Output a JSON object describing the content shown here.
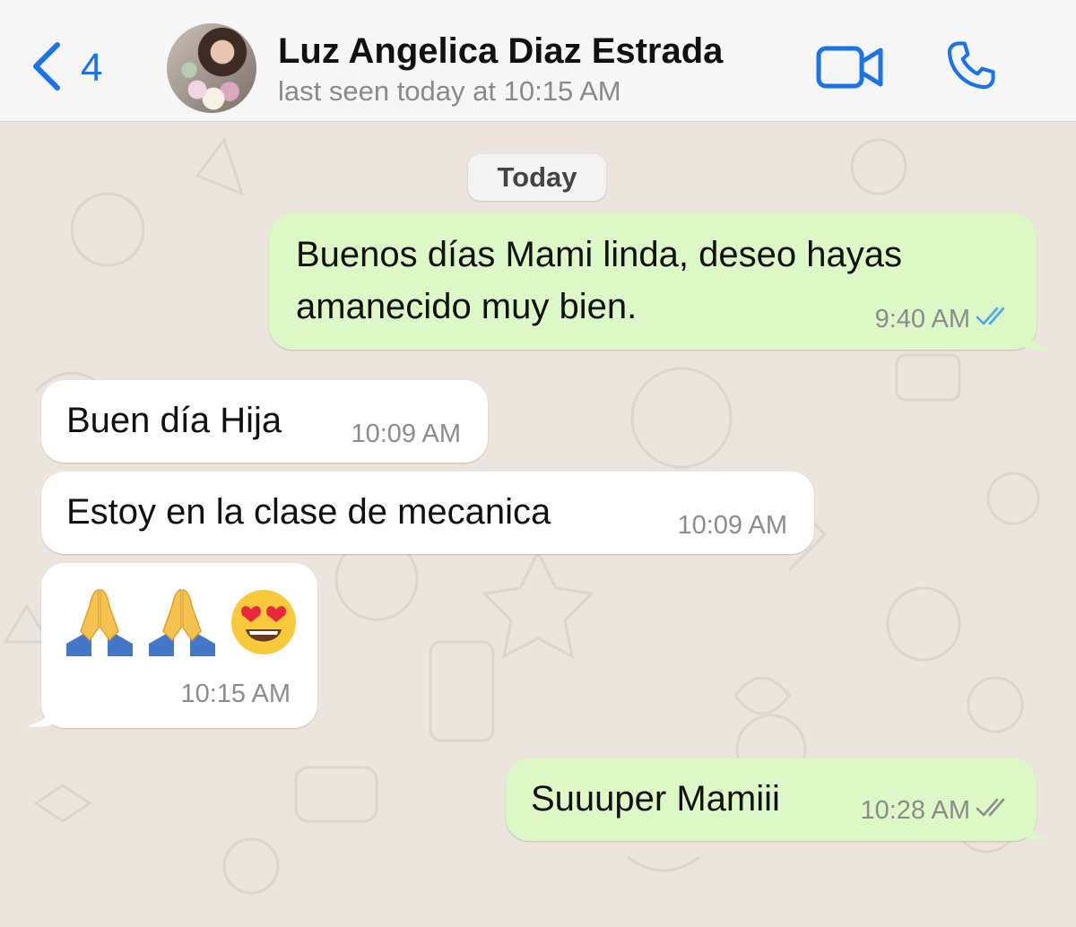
{
  "header": {
    "back_count": "4",
    "contact_name": "Luz Angelica Diaz Estrada",
    "last_seen": "last seen today at 10:15 AM"
  },
  "chat": {
    "date_label": "Today",
    "messages": [
      {
        "direction": "outgoing",
        "lines": [
          "Buenos días Mami linda, deseo hayas",
          "amanecido muy bien."
        ],
        "time": "9:40 AM",
        "status": "read"
      },
      {
        "direction": "incoming",
        "text": "Buen día Hija",
        "time": "10:09 AM"
      },
      {
        "direction": "incoming",
        "text": "Estoy en la clase de mecanica",
        "time": "10:09 AM"
      },
      {
        "direction": "incoming",
        "emojis": [
          "folded-hands",
          "folded-hands",
          "heart-eyes-face"
        ],
        "time": "10:15 AM"
      },
      {
        "direction": "outgoing",
        "text": "Suuuper Mamiii",
        "time": "10:28 AM",
        "status": "delivered"
      }
    ]
  },
  "colors": {
    "accent": "#1a73e8",
    "outgoing_bubble": "#dcf8c6",
    "incoming_bubble": "#ffffff",
    "read_ticks": "#4fa3f7",
    "delivered_ticks": "#8c8c8c",
    "wallpaper": "#ece5dd"
  },
  "icons": {
    "back": "chevron-left-icon",
    "video": "video-camera-icon",
    "call": "phone-icon",
    "read": "double-check-icon",
    "delivered": "double-check-icon"
  }
}
